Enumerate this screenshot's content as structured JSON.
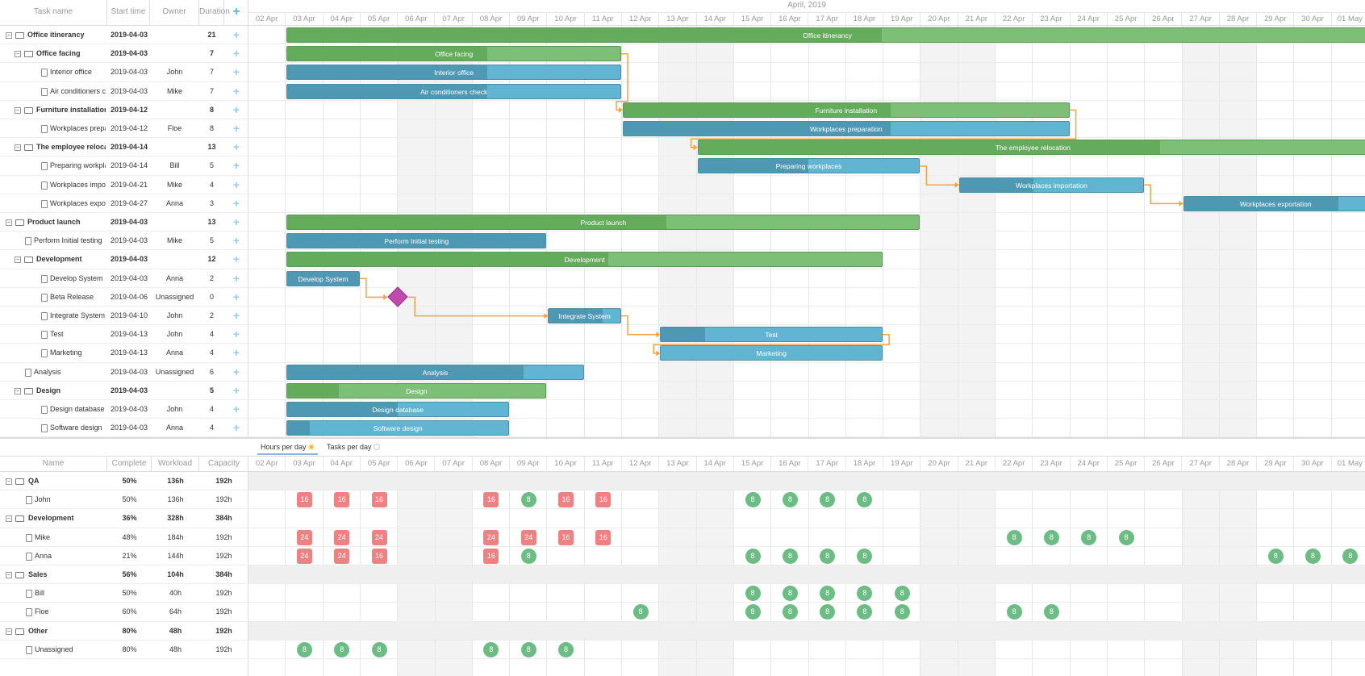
{
  "grid": {
    "columns": {
      "task_name": "Task name",
      "start_time": "Start time",
      "owner": "Owner",
      "duration": "Duration",
      "add": "+"
    },
    "rows": [
      {
        "name": "Office itinerancy",
        "start": "2019-04-03",
        "owner": "",
        "duration": 21,
        "level": 0,
        "type": "project",
        "progress": 0.55
      },
      {
        "name": "Office facing",
        "start": "2019-04-03",
        "owner": "",
        "duration": 7,
        "level": 1,
        "type": "project",
        "progress": 0.6
      },
      {
        "name": "Interior office",
        "start": "2019-04-03",
        "owner": "John",
        "duration": 7,
        "level": 2,
        "type": "task",
        "progress": 0.6
      },
      {
        "name": "Air conditioners check",
        "start": "2019-04-03",
        "owner": "Mike",
        "duration": 7,
        "level": 2,
        "type": "task",
        "progress": 0.6
      },
      {
        "name": "Furniture installation",
        "start": "2019-04-12",
        "owner": "",
        "duration": 8,
        "level": 1,
        "type": "project",
        "progress": 0.6
      },
      {
        "name": "Workplaces preparation",
        "start": "2019-04-12",
        "owner": "Floe",
        "duration": 8,
        "level": 2,
        "type": "task",
        "progress": 0.6
      },
      {
        "name": "The employee relocation",
        "start": "2019-04-14",
        "owner": "",
        "duration": 13,
        "level": 1,
        "type": "project",
        "progress": 0.69
      },
      {
        "name": "Preparing workplaces",
        "start": "2019-04-14",
        "owner": "Bill",
        "duration": 5,
        "level": 2,
        "type": "task",
        "progress": 0.5
      },
      {
        "name": "Workplaces importation",
        "start": "2019-04-21",
        "owner": "Mike",
        "duration": 4,
        "level": 2,
        "type": "task",
        "progress": 0.4
      },
      {
        "name": "Workplaces exportation",
        "start": "2019-04-27",
        "owner": "Anna",
        "duration": 3,
        "level": 2,
        "type": "task",
        "progress": 0.84
      },
      {
        "name": "Product launch",
        "start": "2019-04-03",
        "owner": "",
        "duration": 13,
        "level": 0,
        "type": "project",
        "progress": 0.6
      },
      {
        "name": "Perform Initial testing",
        "start": "2019-04-03",
        "owner": "Mike",
        "duration": 5,
        "level": 1,
        "type": "task",
        "progress": 1
      },
      {
        "name": "Development",
        "start": "2019-04-03",
        "owner": "",
        "duration": 12,
        "level": 1,
        "type": "project",
        "progress": 0.54
      },
      {
        "name": "Develop System",
        "start": "2019-04-03",
        "owner": "Anna",
        "duration": 2,
        "level": 2,
        "type": "task",
        "progress": 1
      },
      {
        "name": "Beta Release",
        "start": "2019-04-06",
        "owner": "Unassigned",
        "duration": 0,
        "level": 2,
        "type": "milestone",
        "progress": 0
      },
      {
        "name": "Integrate System",
        "start": "2019-04-10",
        "owner": "John",
        "duration": 2,
        "level": 2,
        "type": "task",
        "progress": 0.75
      },
      {
        "name": "Test",
        "start": "2019-04-13",
        "owner": "John",
        "duration": 4,
        "level": 2,
        "type": "task",
        "progress": 0.2
      },
      {
        "name": "Marketing",
        "start": "2019-04-13",
        "owner": "Anna",
        "duration": 4,
        "level": 2,
        "type": "task",
        "progress": 0
      },
      {
        "name": "Analysis",
        "start": "2019-04-03",
        "owner": "Unassigned",
        "duration": 6,
        "level": 1,
        "type": "task",
        "progress": 0.8
      },
      {
        "name": "Design",
        "start": "2019-04-03",
        "owner": "",
        "duration": 5,
        "level": 1,
        "type": "project",
        "progress": 0.2
      },
      {
        "name": "Design database",
        "start": "2019-04-03",
        "owner": "John",
        "duration": 4,
        "level": 2,
        "type": "task",
        "progress": 0.5
      },
      {
        "name": "Software design",
        "start": "2019-04-03",
        "owner": "Anna",
        "duration": 4,
        "level": 2,
        "type": "task",
        "progress": 0.1
      }
    ],
    "links": [
      [
        1,
        4
      ],
      [
        4,
        6
      ],
      [
        7,
        8
      ],
      [
        8,
        9
      ],
      [
        13,
        14
      ],
      [
        14,
        15
      ],
      [
        15,
        16
      ],
      [
        16,
        17
      ]
    ]
  },
  "timeline": {
    "month": "April, 2019",
    "days": [
      "02 Apr",
      "03 Apr",
      "04 Apr",
      "05 Apr",
      "06 Apr",
      "07 Apr",
      "08 Apr",
      "09 Apr",
      "10 Apr",
      "11 Apr",
      "12 Apr",
      "13 Apr",
      "14 Apr",
      "15 Apr",
      "16 Apr",
      "17 Apr",
      "18 Apr",
      "19 Apr",
      "20 Apr",
      "21 Apr",
      "22 Apr",
      "23 Apr",
      "24 Apr",
      "25 Apr",
      "26 Apr",
      "27 Apr",
      "28 Apr",
      "29 Apr",
      "30 Apr",
      "01 May"
    ],
    "weekend_days": [
      "06 Apr",
      "07 Apr",
      "13 Apr",
      "14 Apr",
      "20 Apr",
      "21 Apr",
      "27 Apr",
      "28 Apr"
    ]
  },
  "resources": {
    "tabs": [
      {
        "label": "Hours per day",
        "active": true
      },
      {
        "label": "Tasks per day",
        "active": false
      }
    ],
    "columns": {
      "name": "Name",
      "complete": "Complete",
      "workload": "Workload",
      "capacity": "Capacity"
    },
    "rows": [
      {
        "name": "QA",
        "complete": "50%",
        "workload": "136h",
        "capacity": "192h",
        "group": true,
        "cells": {}
      },
      {
        "name": "John",
        "complete": "50%",
        "workload": "136h",
        "capacity": "192h",
        "group": false,
        "cells": {
          "03 Apr": 16,
          "04 Apr": 16,
          "05 Apr": 16,
          "08 Apr": 16,
          "09 Apr": 8,
          "10 Apr": 16,
          "11 Apr": 16,
          "15 Apr": 8,
          "16 Apr": 8,
          "17 Apr": 8,
          "18 Apr": 8
        }
      },
      {
        "name": "Development",
        "complete": "36%",
        "workload": "328h",
        "capacity": "384h",
        "group": true,
        "cells": {}
      },
      {
        "name": "Mike",
        "complete": "48%",
        "workload": "184h",
        "capacity": "192h",
        "group": false,
        "cells": {
          "03 Apr": 24,
          "04 Apr": 24,
          "05 Apr": 24,
          "08 Apr": 24,
          "09 Apr": 24,
          "10 Apr": 16,
          "11 Apr": 16,
          "22 Apr": 8,
          "23 Apr": 8,
          "24 Apr": 8,
          "25 Apr": 8
        }
      },
      {
        "name": "Anna",
        "complete": "21%",
        "workload": "144h",
        "capacity": "192h",
        "group": false,
        "cells": {
          "03 Apr": 24,
          "04 Apr": 24,
          "05 Apr": 16,
          "08 Apr": 16,
          "09 Apr": 8,
          "15 Apr": 8,
          "16 Apr": 8,
          "17 Apr": 8,
          "18 Apr": 8,
          "29 Apr": 8,
          "30 Apr": 8,
          "01 May": 8
        }
      },
      {
        "name": "Sales",
        "complete": "56%",
        "workload": "104h",
        "capacity": "384h",
        "group": true,
        "cells": {}
      },
      {
        "name": "Bill",
        "complete": "50%",
        "workload": "40h",
        "capacity": "192h",
        "group": false,
        "cells": {
          "15 Apr": 8,
          "16 Apr": 8,
          "17 Apr": 8,
          "18 Apr": 8,
          "19 Apr": 8
        }
      },
      {
        "name": "Floe",
        "complete": "60%",
        "workload": "64h",
        "capacity": "192h",
        "group": false,
        "cells": {
          "12 Apr": 8,
          "15 Apr": 8,
          "16 Apr": 8,
          "17 Apr": 8,
          "18 Apr": 8,
          "19 Apr": 8,
          "22 Apr": 8,
          "23 Apr": 8
        }
      },
      {
        "name": "Other",
        "complete": "80%",
        "workload": "48h",
        "capacity": "192h",
        "group": true,
        "cells": {}
      },
      {
        "name": "Unassigned",
        "complete": "80%",
        "workload": "48h",
        "capacity": "192h",
        "group": false,
        "cells": {
          "03 Apr": 8,
          "04 Apr": 8,
          "05 Apr": 8,
          "08 Apr": 8,
          "09 Apr": 8,
          "10 Apr": 8
        }
      }
    ]
  },
  "colors": {
    "project": "#65ab5c",
    "project_light": "#7dbf76",
    "task": "#4f98b3",
    "task_light": "#62b5d2",
    "milestone": "#c04aab",
    "link": "#f0a540",
    "overload": "#ee8182",
    "normal": "#6bbd84",
    "weekend": "#f3f3f3"
  }
}
